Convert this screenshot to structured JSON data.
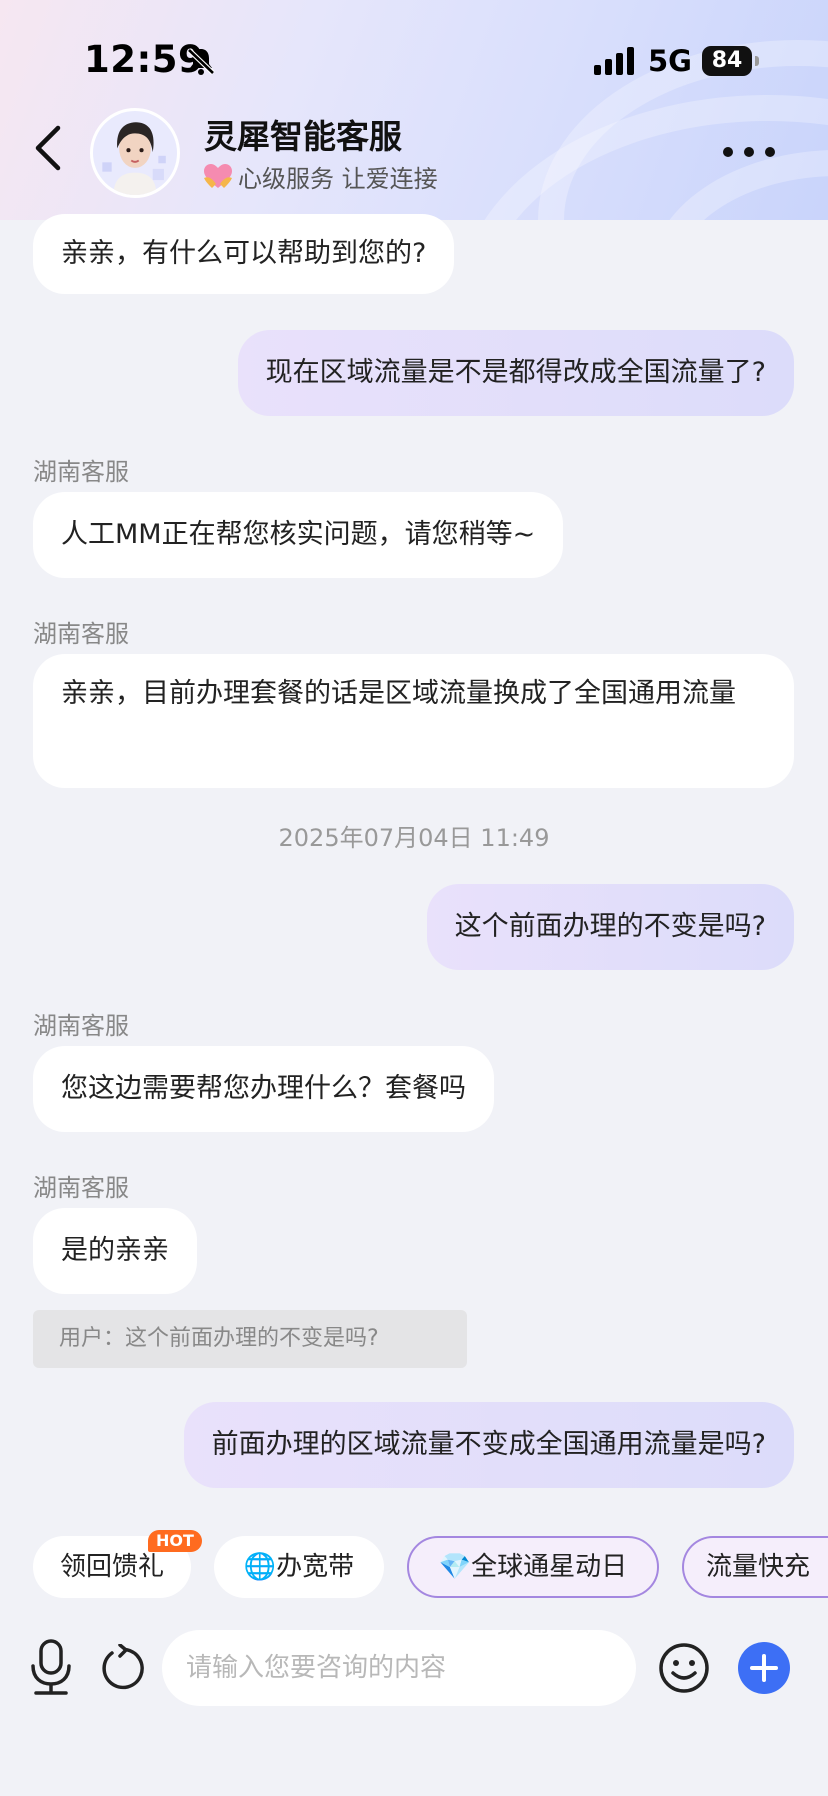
{
  "status_bar": {
    "time": "12:59",
    "network": "5G",
    "battery": "84"
  },
  "header": {
    "title": "灵犀智能客服",
    "slogan": "心级服务 让爱连接"
  },
  "messages": [
    {
      "type": "in",
      "text": "亲亲，有什么可以帮助到您的?"
    },
    {
      "type": "out",
      "text": "现在区域流量是不是都得改成全国流量了?"
    },
    {
      "type": "in",
      "sender": "湖南客服",
      "text": "人工MM正在帮您核实问题，请您稍等~"
    },
    {
      "type": "in",
      "sender": "湖南客服",
      "text": "亲亲，目前办理套餐的话是区域流量换成了全国通用流量"
    },
    {
      "type": "time",
      "text": "2025年07月04日 11:49"
    },
    {
      "type": "out",
      "text": "这个前面办理的不变是吗?"
    },
    {
      "type": "in",
      "sender": "湖南客服",
      "text": "您这边需要帮您办理什么？套餐吗"
    },
    {
      "type": "in",
      "sender": "湖南客服",
      "text": "是的亲亲"
    },
    {
      "type": "quote",
      "text": "用户：这个前面办理的不变是吗?"
    },
    {
      "type": "out",
      "text": "前面办理的区域流量不变成全国通用流量是吗?"
    }
  ],
  "chips": [
    {
      "label": "领回馈礼",
      "badge": "HOT"
    },
    {
      "label": "🌐办宽带"
    },
    {
      "label": "💎全球通星动日"
    },
    {
      "label": "流量快充"
    }
  ],
  "input": {
    "placeholder": "请输入您要咨询的内容"
  },
  "colors": {
    "accent": "#3d6ff5",
    "chip_border": "#a487e0",
    "hot": "#ff6b1f"
  }
}
